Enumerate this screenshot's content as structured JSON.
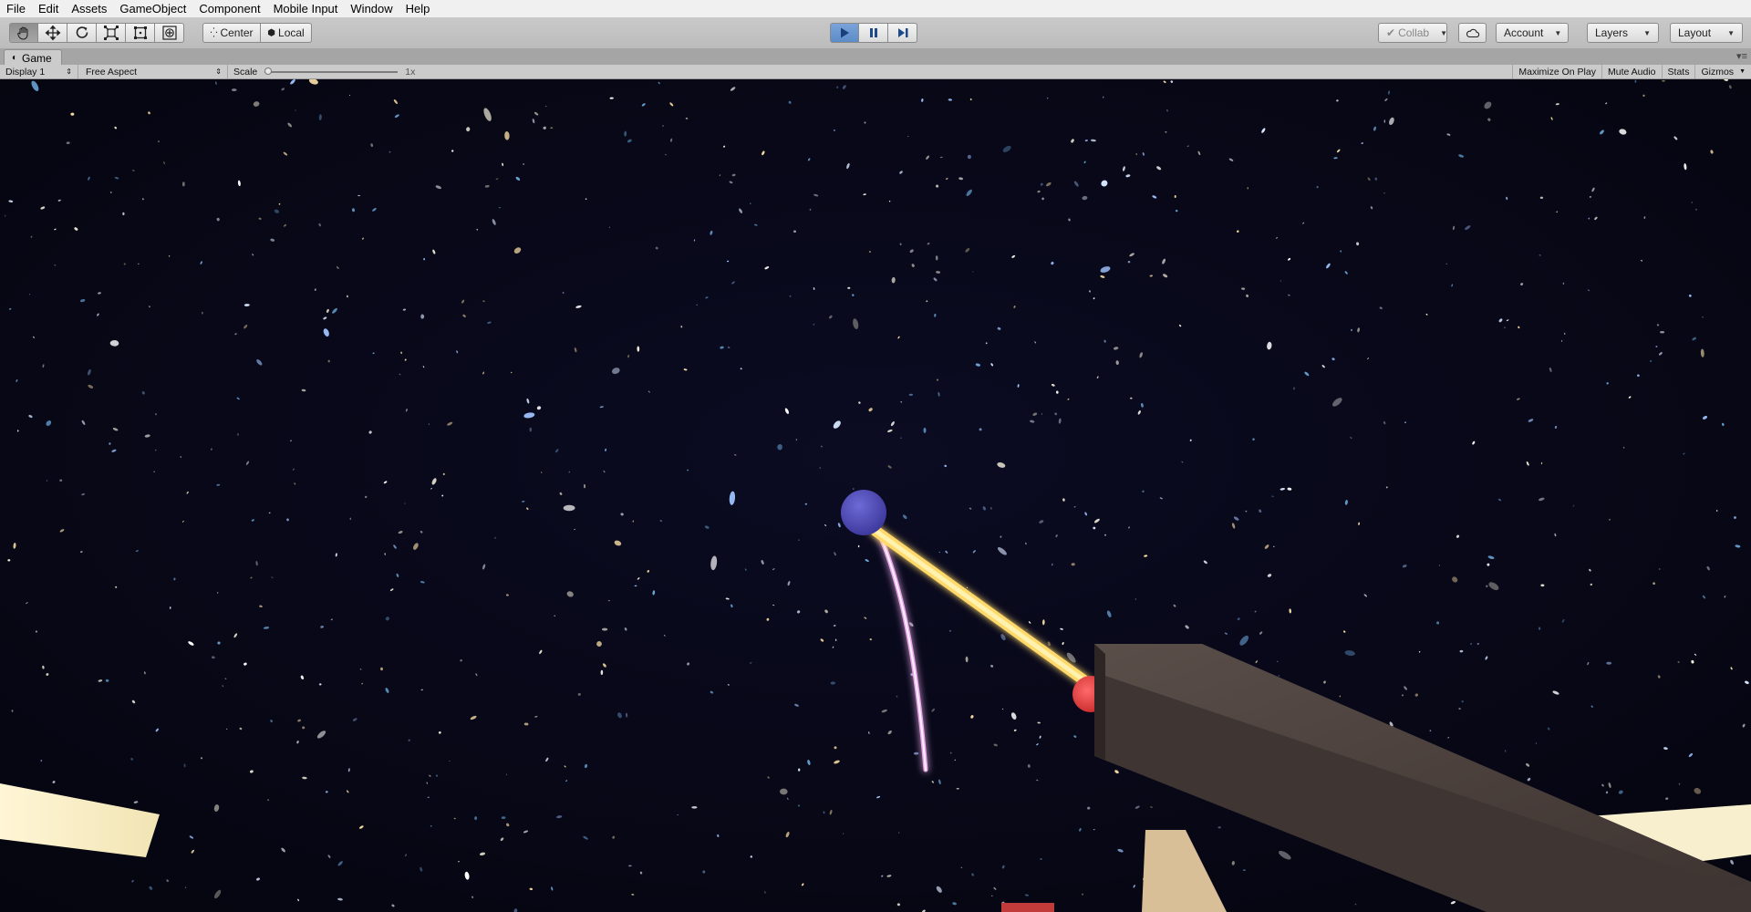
{
  "menu": [
    "File",
    "Edit",
    "Assets",
    "GameObject",
    "Component",
    "Mobile Input",
    "Window",
    "Help"
  ],
  "toolbar": {
    "tools": [
      "hand-tool-icon",
      "move-tool-icon",
      "rotate-tool-icon",
      "scale-tool-icon",
      "rect-tool-icon",
      "transform-tool-icon"
    ],
    "pivot_label": "Center",
    "space_label": "Local",
    "collab_label": "Collab",
    "account_label": "Account",
    "layers_label": "Layers",
    "layout_label": "Layout"
  },
  "game_view": {
    "tab_label": "Game",
    "display_label": "Display 1",
    "aspect_label": "Free Aspect",
    "scale_label": "Scale",
    "scale_value": "1x",
    "scale_level": 0,
    "maximize_label": "Maximize On Play",
    "mute_label": "Mute Audio",
    "stats_label": "Stats",
    "gizmos_label": "Gizmos"
  },
  "colors": {
    "play_active": "#5c8cc8",
    "space_bg": "#080817",
    "blue_sphere": "#4a46b4",
    "red_sphere": "#e03a3a",
    "yellow_beam": "#ffe58a",
    "pink_trail": "#e8a8e8",
    "gun_body": "#4a3f3b",
    "panel_light": "#f7efce"
  }
}
